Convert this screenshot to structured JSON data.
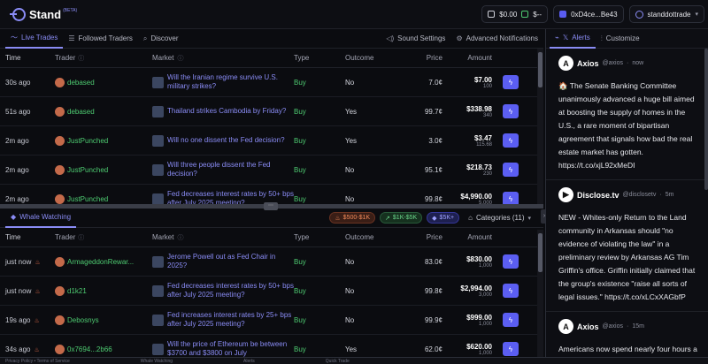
{
  "app": {
    "name": "Stand",
    "badge": "(BETA)"
  },
  "header": {
    "balance": "$0.00",
    "cash": "$--",
    "address": "0xD4ce...Be43",
    "username": "standdottrade"
  },
  "live": {
    "tabs": [
      {
        "label": "Live Trades",
        "icon": "pulse-icon"
      },
      {
        "label": "Followed Traders",
        "icon": "list-icon"
      },
      {
        "label": "Discover",
        "icon": "search-icon"
      }
    ],
    "right_tabs": [
      {
        "label": "Sound Settings",
        "icon": "speaker-icon"
      },
      {
        "label": "Advanced Notifications",
        "icon": "gear-icon"
      }
    ],
    "columns": [
      "Time",
      "Trader",
      "Market",
      "Type",
      "Outcome",
      "Price",
      "Amount"
    ],
    "rows": [
      {
        "time": "30s ago",
        "trader": "debased",
        "market": "Will the Iranian regime survive U.S. military strikes?",
        "type": "Buy",
        "outcome": "No",
        "price": "7.0¢",
        "amount": "$7.00",
        "shares": "100"
      },
      {
        "time": "51s ago",
        "trader": "debased",
        "market": "Thailand strikes Cambodia by Friday?",
        "type": "Buy",
        "outcome": "Yes",
        "price": "99.7¢",
        "amount": "$338.98",
        "shares": "340"
      },
      {
        "time": "2m ago",
        "trader": "JustPunched",
        "market": "Will no one dissent the Fed decision?",
        "type": "Buy",
        "outcome": "Yes",
        "price": "3.0¢",
        "amount": "$3.47",
        "shares": "115.68"
      },
      {
        "time": "2m ago",
        "trader": "JustPunched",
        "market": "Will three people dissent the Fed decision?",
        "type": "Buy",
        "outcome": "No",
        "price": "95.1¢",
        "amount": "$218.73",
        "shares": "230"
      },
      {
        "time": "2m ago",
        "trader": "JustPunched",
        "market": "Fed decreases interest rates by 50+ bps after July 2025 meeting?",
        "type": "Buy",
        "outcome": "No",
        "price": "99.8¢",
        "amount": "$4,990.00",
        "shares": "5,000"
      }
    ]
  },
  "whale": {
    "tab": "Whale Watching",
    "filters": [
      "$500-$1K",
      "$1K-$5K",
      "$5K+"
    ],
    "categories": "Categories (11)",
    "columns": [
      "Time",
      "Trader",
      "Market",
      "Type",
      "Outcome",
      "Price",
      "Amount"
    ],
    "rows": [
      {
        "time": "just now",
        "trader": "ArmageddonRewar...",
        "market": "Jerome Powell out as Fed Chair in 2025?",
        "type": "Buy",
        "outcome": "No",
        "price": "83.0¢",
        "amount": "$830.00",
        "shares": "1,000"
      },
      {
        "time": "just now",
        "trader": "d1k21",
        "market": "Fed decreases interest rates by 50+ bps after July 2025 meeting?",
        "type": "Buy",
        "outcome": "No",
        "price": "99.8¢",
        "amount": "$2,994.00",
        "shares": "3,000"
      },
      {
        "time": "19s ago",
        "trader": "Debosnys",
        "market": "Fed increases interest rates by 25+ bps after July 2025 meeting?",
        "type": "Buy",
        "outcome": "No",
        "price": "99.9¢",
        "amount": "$999.00",
        "shares": "1,000"
      },
      {
        "time": "34s ago",
        "trader": "0x7694...2b66",
        "market": "Will the price of Ethereum be between $3700 and $3800 on July",
        "type": "Buy",
        "outcome": "Yes",
        "price": "62.0¢",
        "amount": "$620.00",
        "shares": "1,000"
      }
    ]
  },
  "alerts": {
    "tabs": [
      "Alerts",
      "Customize"
    ],
    "posts": [
      {
        "source": "Axios",
        "handle": "@axios",
        "time": "now",
        "avatar": "A",
        "text": "🏠 The Senate Banking Committee unanimously advanced a huge bill aimed at boosting the supply of homes in the U.S., a rare moment of bipartisan agreement that signals how bad the real estate market has gotten. https://t.co/xjL92xMeDI"
      },
      {
        "source": "Disclose.tv",
        "handle": "@disclosetv",
        "time": "5m",
        "avatar": "▶",
        "text": "NEW - Whites-only Return to the Land community in Arkansas should \"no evidence of violating the law\" in a preliminary review by Arkansas AG Tim Griffin's office. Griffin initially claimed that the group's existence \"raise all sorts of legal issues.\" https://t.co/xLCxXAGbfP"
      },
      {
        "source": "Axios",
        "handle": "@axios",
        "time": "15m",
        "avatar": "A",
        "text": "Americans now spend nearly four hours a day thinking about money, the"
      }
    ]
  },
  "footer": [
    "Privacy Policy  •  Terms of Service",
    "Whale Watching",
    "Alerts",
    "Quick Trade"
  ],
  "colors": {
    "accent": "#8a8cf5",
    "buy": "#4ecb71",
    "button": "#5b5ef2"
  }
}
